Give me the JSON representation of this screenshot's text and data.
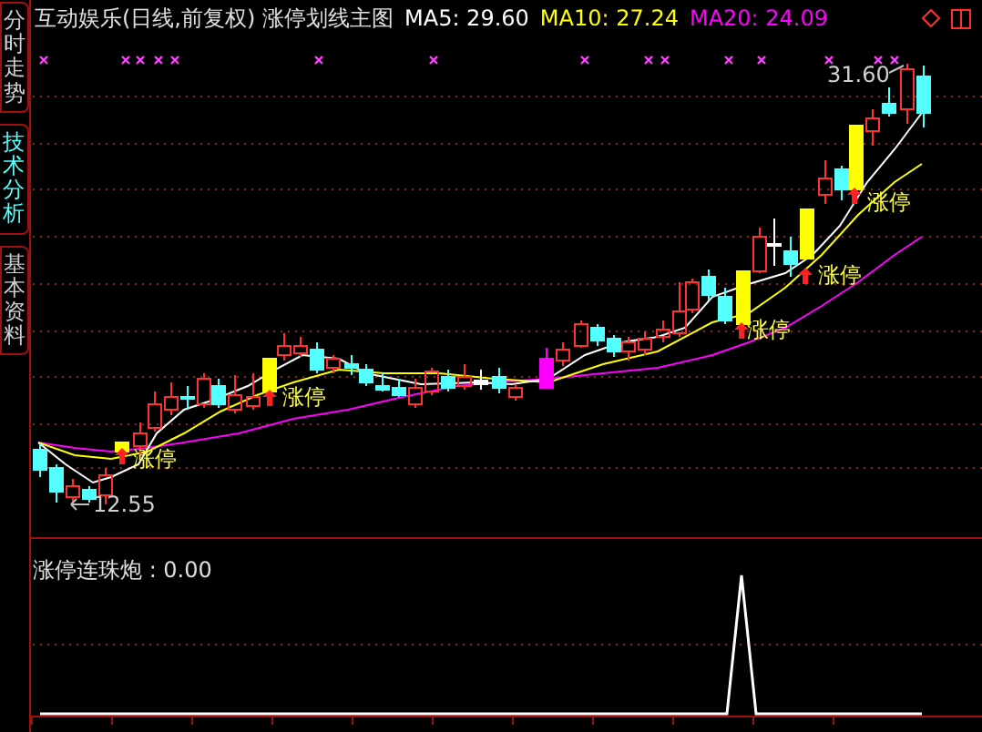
{
  "sidebar": {
    "tabs": [
      {
        "label": "分时走势",
        "selected": false
      },
      {
        "label": "技术分析",
        "selected": true
      },
      {
        "label": "基本资料",
        "selected": false
      }
    ]
  },
  "chart": {
    "title": "互动娱乐(日线,前复权) 涨停划线主图",
    "indicators": [
      {
        "label": "MA5: 29.60",
        "color": "#ffffff"
      },
      {
        "label": "MA10: 27.24",
        "color": "#ffff00"
      },
      {
        "label": "MA20: 24.09",
        "color": "#ff00ff"
      }
    ],
    "high_label": "31.60",
    "low_label": "12.55",
    "limit_up_labels": [
      "涨停",
      "涨停",
      "涨停",
      "涨停",
      "涨停"
    ]
  },
  "indicator_panel": {
    "label": "涨停连珠炮 : 0.00"
  }
}
